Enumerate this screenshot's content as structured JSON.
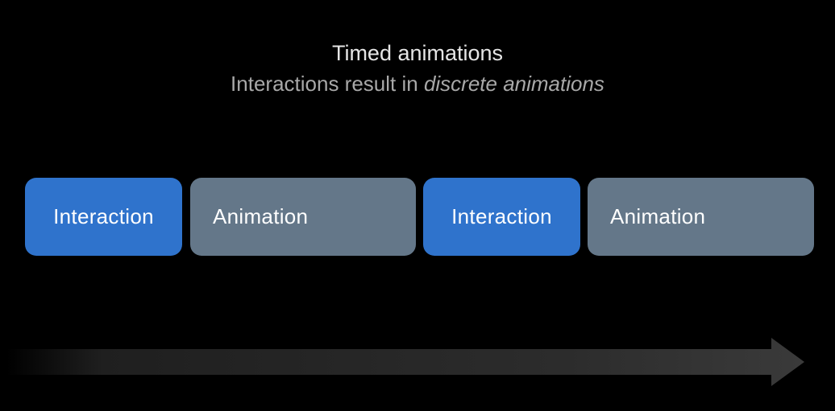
{
  "header": {
    "title": "Timed animations",
    "subtitle_plain": "Interactions result in ",
    "subtitle_emphasis": "discrete animations"
  },
  "timeline": {
    "blocks": [
      {
        "label": "Interaction",
        "kind": "interaction"
      },
      {
        "label": "Animation",
        "kind": "animation"
      },
      {
        "label": "Interaction",
        "kind": "interaction"
      },
      {
        "label": "Animation",
        "kind": "animation"
      }
    ]
  },
  "colors": {
    "background": "#000000",
    "interaction": "#2f73cc",
    "animation": "#647789",
    "arrow": "#3a3a3a"
  },
  "icons": {
    "time_arrow": "right-arrow-icon"
  }
}
